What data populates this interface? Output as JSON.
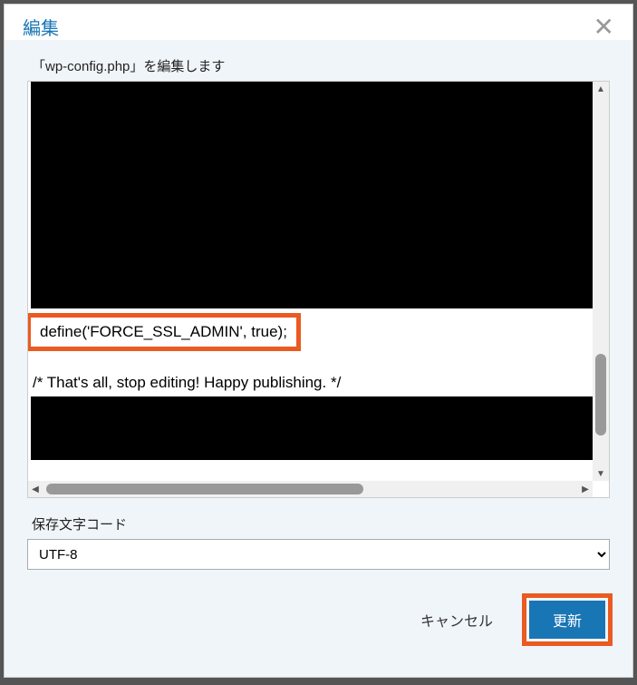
{
  "dialog": {
    "title": "編集",
    "editLabel": "「wp-config.php」を編集します",
    "codeHighlight": "define('FORCE_SSL_ADMIN', true);",
    "codeComment": "/* That's all, stop editing! Happy publishing. */",
    "encodingLabel": "保存文字コード",
    "encodingValue": "UTF-8",
    "cancelLabel": "キャンセル",
    "updateLabel": "更新"
  }
}
